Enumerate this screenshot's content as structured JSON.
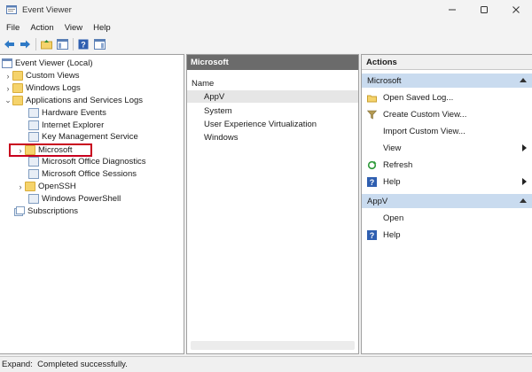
{
  "window": {
    "title": "Event Viewer"
  },
  "menu": [
    "File",
    "Action",
    "View",
    "Help"
  ],
  "toolbar": {
    "icons": [
      "back-arrow-icon",
      "forward-arrow-icon",
      "up-folder-icon",
      "show-hide-tree-icon",
      "help-icon",
      "show-hide-action-pane-icon"
    ]
  },
  "tree": {
    "root": "Event Viewer (Local)",
    "custom_views": "Custom Views",
    "windows_logs": "Windows Logs",
    "apps_services": "Applications and Services Logs",
    "hardware_events": "Hardware Events",
    "internet_explorer": "Internet Explorer",
    "key_management": "Key Management Service",
    "microsoft": "Microsoft",
    "ms_office_diag": "Microsoft Office Diagnostics",
    "ms_office_sessions": "Microsoft Office Sessions",
    "openssh": "OpenSSH",
    "windows_powershell": "Windows PowerShell",
    "subscriptions": "Subscriptions"
  },
  "middle": {
    "header": "Microsoft",
    "column": "Name",
    "rows": [
      "AppV",
      "System",
      "User Experience Virtualization",
      "Windows"
    ]
  },
  "actions": {
    "title": "Actions",
    "section1": "Microsoft",
    "open_saved_log": "Open Saved Log...",
    "create_custom_view": "Create Custom View...",
    "import_custom_view": "Import Custom View...",
    "view": "View",
    "refresh": "Refresh",
    "help": "Help",
    "section2": "AppV",
    "open": "Open",
    "help2": "Help"
  },
  "status": "Expand:  Completed successfully."
}
